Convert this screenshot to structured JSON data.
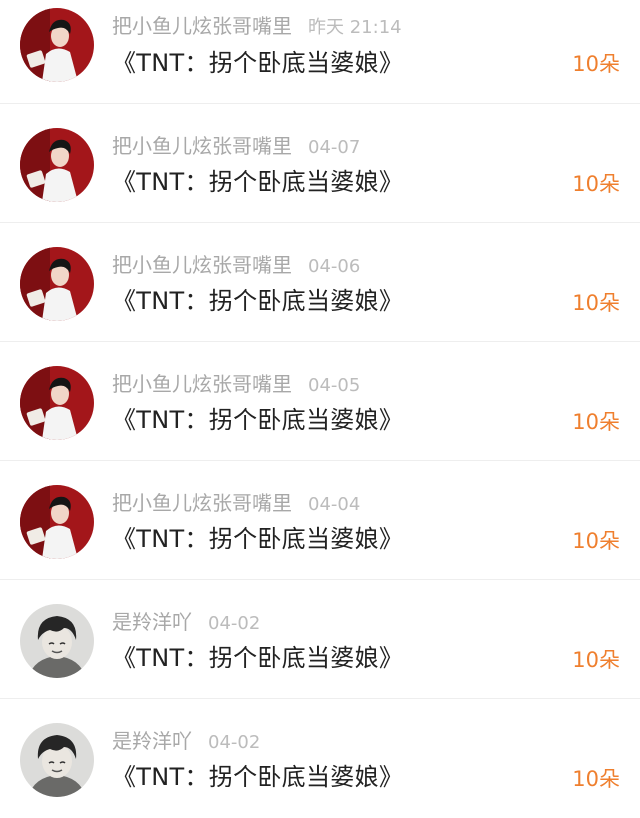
{
  "items": [
    {
      "user": "把小鱼儿炫张哥嘴里",
      "time": "昨天 21:14",
      "title": "《TNT：拐个卧底当婆娘》",
      "count": "10朵",
      "avatar": "avatar-red"
    },
    {
      "user": "把小鱼儿炫张哥嘴里",
      "time": "04-07",
      "title": "《TNT：拐个卧底当婆娘》",
      "count": "10朵",
      "avatar": "avatar-red"
    },
    {
      "user": "把小鱼儿炫张哥嘴里",
      "time": "04-06",
      "title": "《TNT：拐个卧底当婆娘》",
      "count": "10朵",
      "avatar": "avatar-red"
    },
    {
      "user": "把小鱼儿炫张哥嘴里",
      "time": "04-05",
      "title": "《TNT：拐个卧底当婆娘》",
      "count": "10朵",
      "avatar": "avatar-red"
    },
    {
      "user": "把小鱼儿炫张哥嘴里",
      "time": "04-04",
      "title": "《TNT：拐个卧底当婆娘》",
      "count": "10朵",
      "avatar": "avatar-red"
    },
    {
      "user": "是羚洋吖",
      "time": "04-02",
      "title": "《TNT：拐个卧底当婆娘》",
      "count": "10朵",
      "avatar": "avatar-dark"
    },
    {
      "user": "是羚洋吖",
      "time": "04-02",
      "title": "《TNT：拐个卧底当婆娘》",
      "count": "10朵",
      "avatar": "avatar-dark"
    }
  ],
  "colors": {
    "accent": "#ef7f2e",
    "title_text": "#222222",
    "meta_text": "#a8a8a8",
    "divider": "#eeeeee"
  }
}
